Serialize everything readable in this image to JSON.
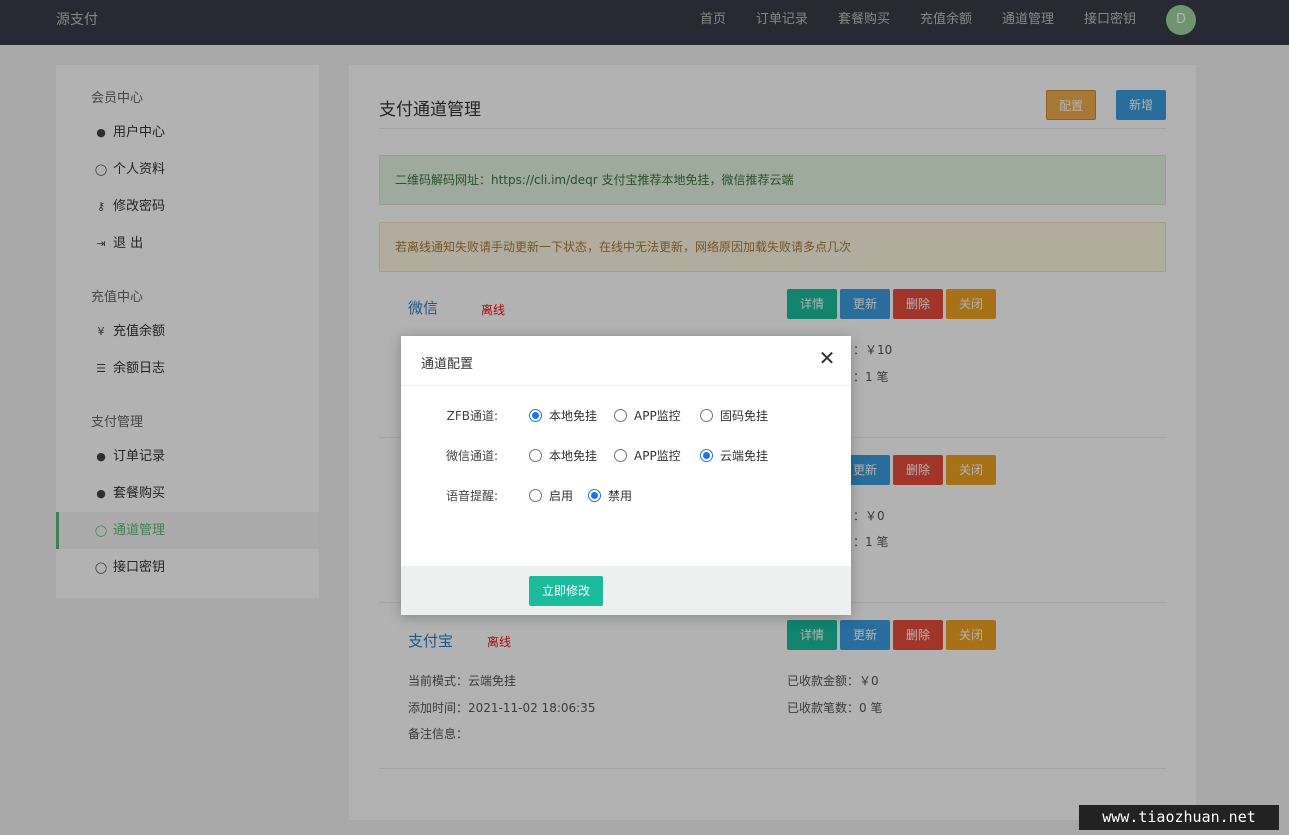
{
  "header": {
    "brand": "源支付",
    "nav": [
      "首页",
      "订单记录",
      "套餐购买",
      "充值余额",
      "通道管理",
      "接口密钥"
    ],
    "avatar": "D"
  },
  "sidebar": {
    "groups": [
      {
        "title": "会员中心",
        "items": [
          {
            "label": "用户中心",
            "icon": "user-circle-icon"
          },
          {
            "label": "个人资料",
            "icon": "user-icon"
          },
          {
            "label": "修改密码",
            "icon": "key-icon"
          },
          {
            "label": "退 出",
            "icon": "sign-out-icon"
          }
        ]
      },
      {
        "title": "充值中心",
        "items": [
          {
            "label": "充值余额",
            "icon": "yen-icon"
          },
          {
            "label": "余额日志",
            "icon": "list-icon"
          }
        ]
      },
      {
        "title": "支付管理",
        "items": [
          {
            "label": "订单记录",
            "icon": "user-circle-icon"
          },
          {
            "label": "套餐购买",
            "icon": "user-circle-icon"
          },
          {
            "label": "通道管理",
            "icon": "user-icon",
            "active": true
          },
          {
            "label": "接口密钥",
            "icon": "user-icon"
          }
        ]
      }
    ]
  },
  "main": {
    "title": "支付通道管理",
    "config_btn": "配置",
    "new_btn": "新增",
    "alert_green": "二维码解码网址：https://cli.im/deqr   支付宝推荐本地免挂，微信推荐云端",
    "alert_yellow": "若离线通知失败请手动更新一下状态，在线中无法更新，网络原因加载失败请多点几次",
    "buttons": {
      "detail": "详情",
      "update": "更新",
      "delete": "删除",
      "close": "关闭"
    },
    "channels": [
      {
        "name": "微信",
        "status": "离线",
        "amount": "：￥10",
        "count": "：1 笔"
      },
      {
        "amount": "：￥0",
        "count": "：1 笔"
      },
      {
        "name": "支付宝",
        "status": "离线",
        "mode": "当前模式：云端免挂",
        "added": "添加时间：2021-11-02 18:06:35",
        "note": "备注信息：",
        "amount": "已收款金额：￥0",
        "count": "已收款笔数：0 笔"
      }
    ]
  },
  "modal": {
    "title": "通道配置",
    "rows": [
      {
        "label": "ZFB通道:",
        "options": [
          "本地免挂",
          "APP监控",
          "固码免挂"
        ],
        "selected": 0
      },
      {
        "label": "微信通道:",
        "options": [
          "本地免挂",
          "APP监控",
          "云端免挂"
        ],
        "selected": 2
      },
      {
        "label": "语音提醒:",
        "options": [
          "启用",
          "禁用"
        ],
        "selected": 1
      }
    ],
    "submit": "立即修改"
  },
  "watermark": "www.tiaozhuan.net",
  "colors": {
    "accent": "#1abc9c",
    "primary": "#3a9dde",
    "danger": "#e74c3c",
    "warning": "#f0a422",
    "active_green": "#5fb878"
  }
}
